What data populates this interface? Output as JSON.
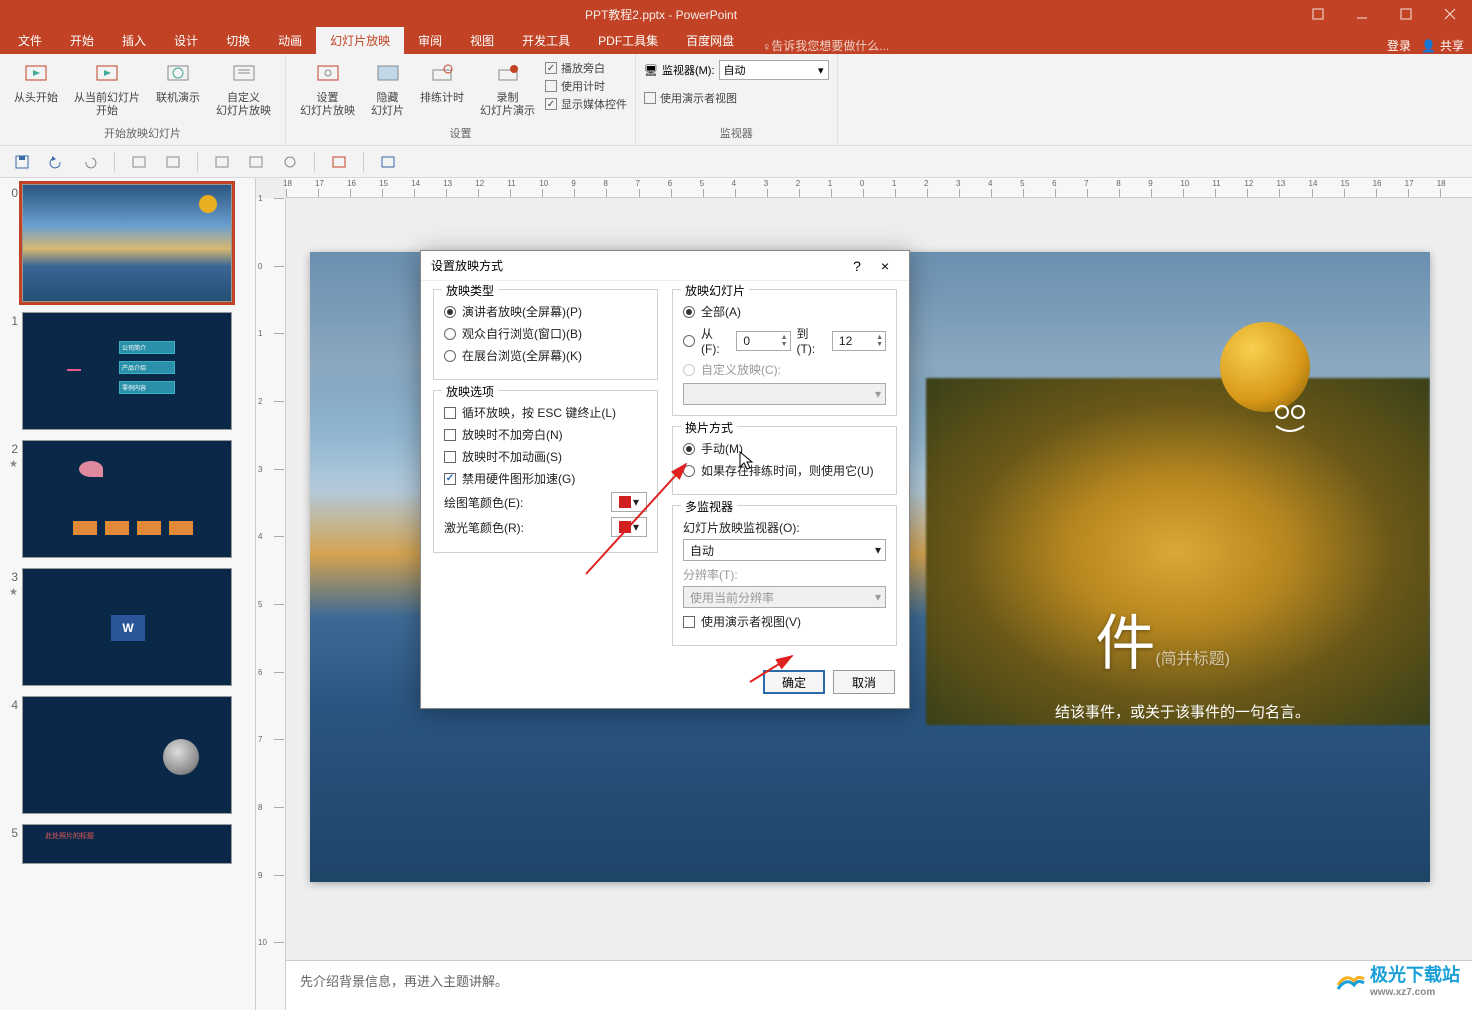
{
  "titlebar": {
    "title": "PPT教程2.pptx - PowerPoint"
  },
  "ribbon": {
    "tabs": [
      "文件",
      "开始",
      "插入",
      "设计",
      "切换",
      "动画",
      "幻灯片放映",
      "审阅",
      "视图",
      "开发工具",
      "PDF工具集",
      "百度网盘"
    ],
    "active_tab_index": 6,
    "tellme_placeholder": "告诉我您想要做什么...",
    "signin": "登录",
    "share": "共享"
  },
  "ribbon_groups": {
    "start_show": {
      "from_begin": "从头开始",
      "from_current": "从当前幻灯片\n开始",
      "online": "联机演示",
      "custom": "自定义\n幻灯片放映",
      "label": "开始放映幻灯片"
    },
    "setup": {
      "setup": "设置\n幻灯片放映",
      "hide": "隐藏\n幻灯片",
      "rehearse": "排练计时",
      "record": "录制\n幻灯片演示",
      "chk_narration": "播放旁白",
      "chk_timings": "使用计时",
      "chk_media": "显示媒体控件",
      "label": "设置"
    },
    "monitors": {
      "monitor_label": "监视器(M):",
      "monitor_value": "自动",
      "presenter_view": "使用演示者视图",
      "label": "监视器"
    }
  },
  "thumbs": [
    {
      "n": "0",
      "star": false
    },
    {
      "n": "1",
      "star": false
    },
    {
      "n": "2",
      "star": true
    },
    {
      "n": "3",
      "star": true
    },
    {
      "n": "4",
      "star": false
    },
    {
      "n": "5",
      "star": false
    }
  ],
  "thumb_content": {
    "t1_boxes": [
      "公司简介",
      "产品介绍",
      "零例内容"
    ],
    "t5_title": "此处照片的标题"
  },
  "ruler_ticks_h": [
    "18",
    "17",
    "16",
    "15",
    "14",
    "13",
    "12",
    "11",
    "10",
    "9",
    "8",
    "7",
    "6",
    "5",
    "4",
    "3",
    "2",
    "1",
    "0",
    "1",
    "2",
    "3",
    "4",
    "5",
    "6",
    "7",
    "8",
    "9",
    "10",
    "11",
    "12",
    "13",
    "14",
    "15",
    "16",
    "17",
    "18"
  ],
  "ruler_ticks_v": [
    "1",
    "0",
    "1",
    "2",
    "3",
    "4",
    "5",
    "6",
    "7",
    "8",
    "9",
    "10"
  ],
  "slide": {
    "big_text": "件",
    "sub_caption": "(简并标题)",
    "subtitle": "结该事件，或关于该事件的一句名言。"
  },
  "notes": "先介绍背景信息，再进入主题讲解。",
  "dialog": {
    "title": "设置放映方式",
    "help": "?",
    "close": "×",
    "show_type": {
      "legend": "放映类型",
      "r1": "演讲者放映(全屏幕)(P)",
      "r2": "观众自行浏览(窗口)(B)",
      "r3": "在展台浏览(全屏幕)(K)"
    },
    "show_options": {
      "legend": "放映选项",
      "c1": "循环放映，按 ESC 键终止(L)",
      "c2": "放映时不加旁白(N)",
      "c3": "放映时不加动画(S)",
      "c4": "禁用硬件图形加速(G)",
      "pen_label": "绘图笔颜色(E):",
      "laser_label": "激光笔颜色(R):"
    },
    "show_slides": {
      "legend": "放映幻灯片",
      "r_all": "全部(A)",
      "r_from": "从(F):",
      "from_val": "0",
      "to_label": "到(T):",
      "to_val": "12",
      "r_custom": "自定义放映(C):"
    },
    "advance": {
      "legend": "换片方式",
      "r_manual": "手动(M)",
      "r_timed": "如果存在排练时间，则使用它(U)"
    },
    "multimon": {
      "legend": "多监视器",
      "mon_label": "幻灯片放映监视器(O):",
      "mon_value": "自动",
      "res_label": "分辨率(T):",
      "res_value": "使用当前分辨率",
      "presenter": "使用演示者视图(V)"
    },
    "ok": "确定",
    "cancel": "取消"
  },
  "watermark": {
    "brand": "极光下载站",
    "url": "www.xz7.com"
  }
}
